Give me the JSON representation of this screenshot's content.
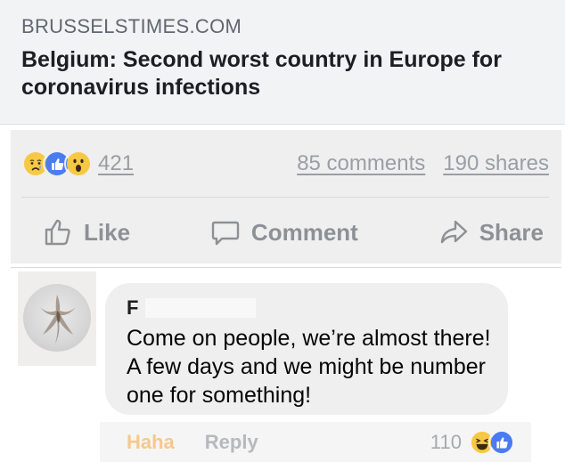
{
  "link_preview": {
    "domain": "BRUSSELSTIMES.COM",
    "title": "Belgium: Second worst country in Europe for coronavirus infections"
  },
  "post": {
    "reactions": [
      "sad-face-icon",
      "like-icon",
      "wow-face-icon"
    ],
    "reaction_count": "421",
    "comments": "85 comments",
    "shares": "190 shares",
    "actions": {
      "like": "Like",
      "comment": "Comment",
      "share": "Share"
    }
  },
  "comment": {
    "author_initial": "F",
    "text": "Come on people, we’re almost there! A few days and we might be number one for something!",
    "actions": {
      "haha": "Haha",
      "reply": "Reply"
    },
    "reaction_count": "110",
    "reactions": [
      "haha-face-icon",
      "like-icon"
    ]
  },
  "colors": {
    "link_card_bg": "#f2f3f5",
    "muted_text": "#8d9196",
    "haha_active": "#f6c98a",
    "like_blue": "#4a7cf0",
    "reaction_yellow": "#f7c843"
  }
}
